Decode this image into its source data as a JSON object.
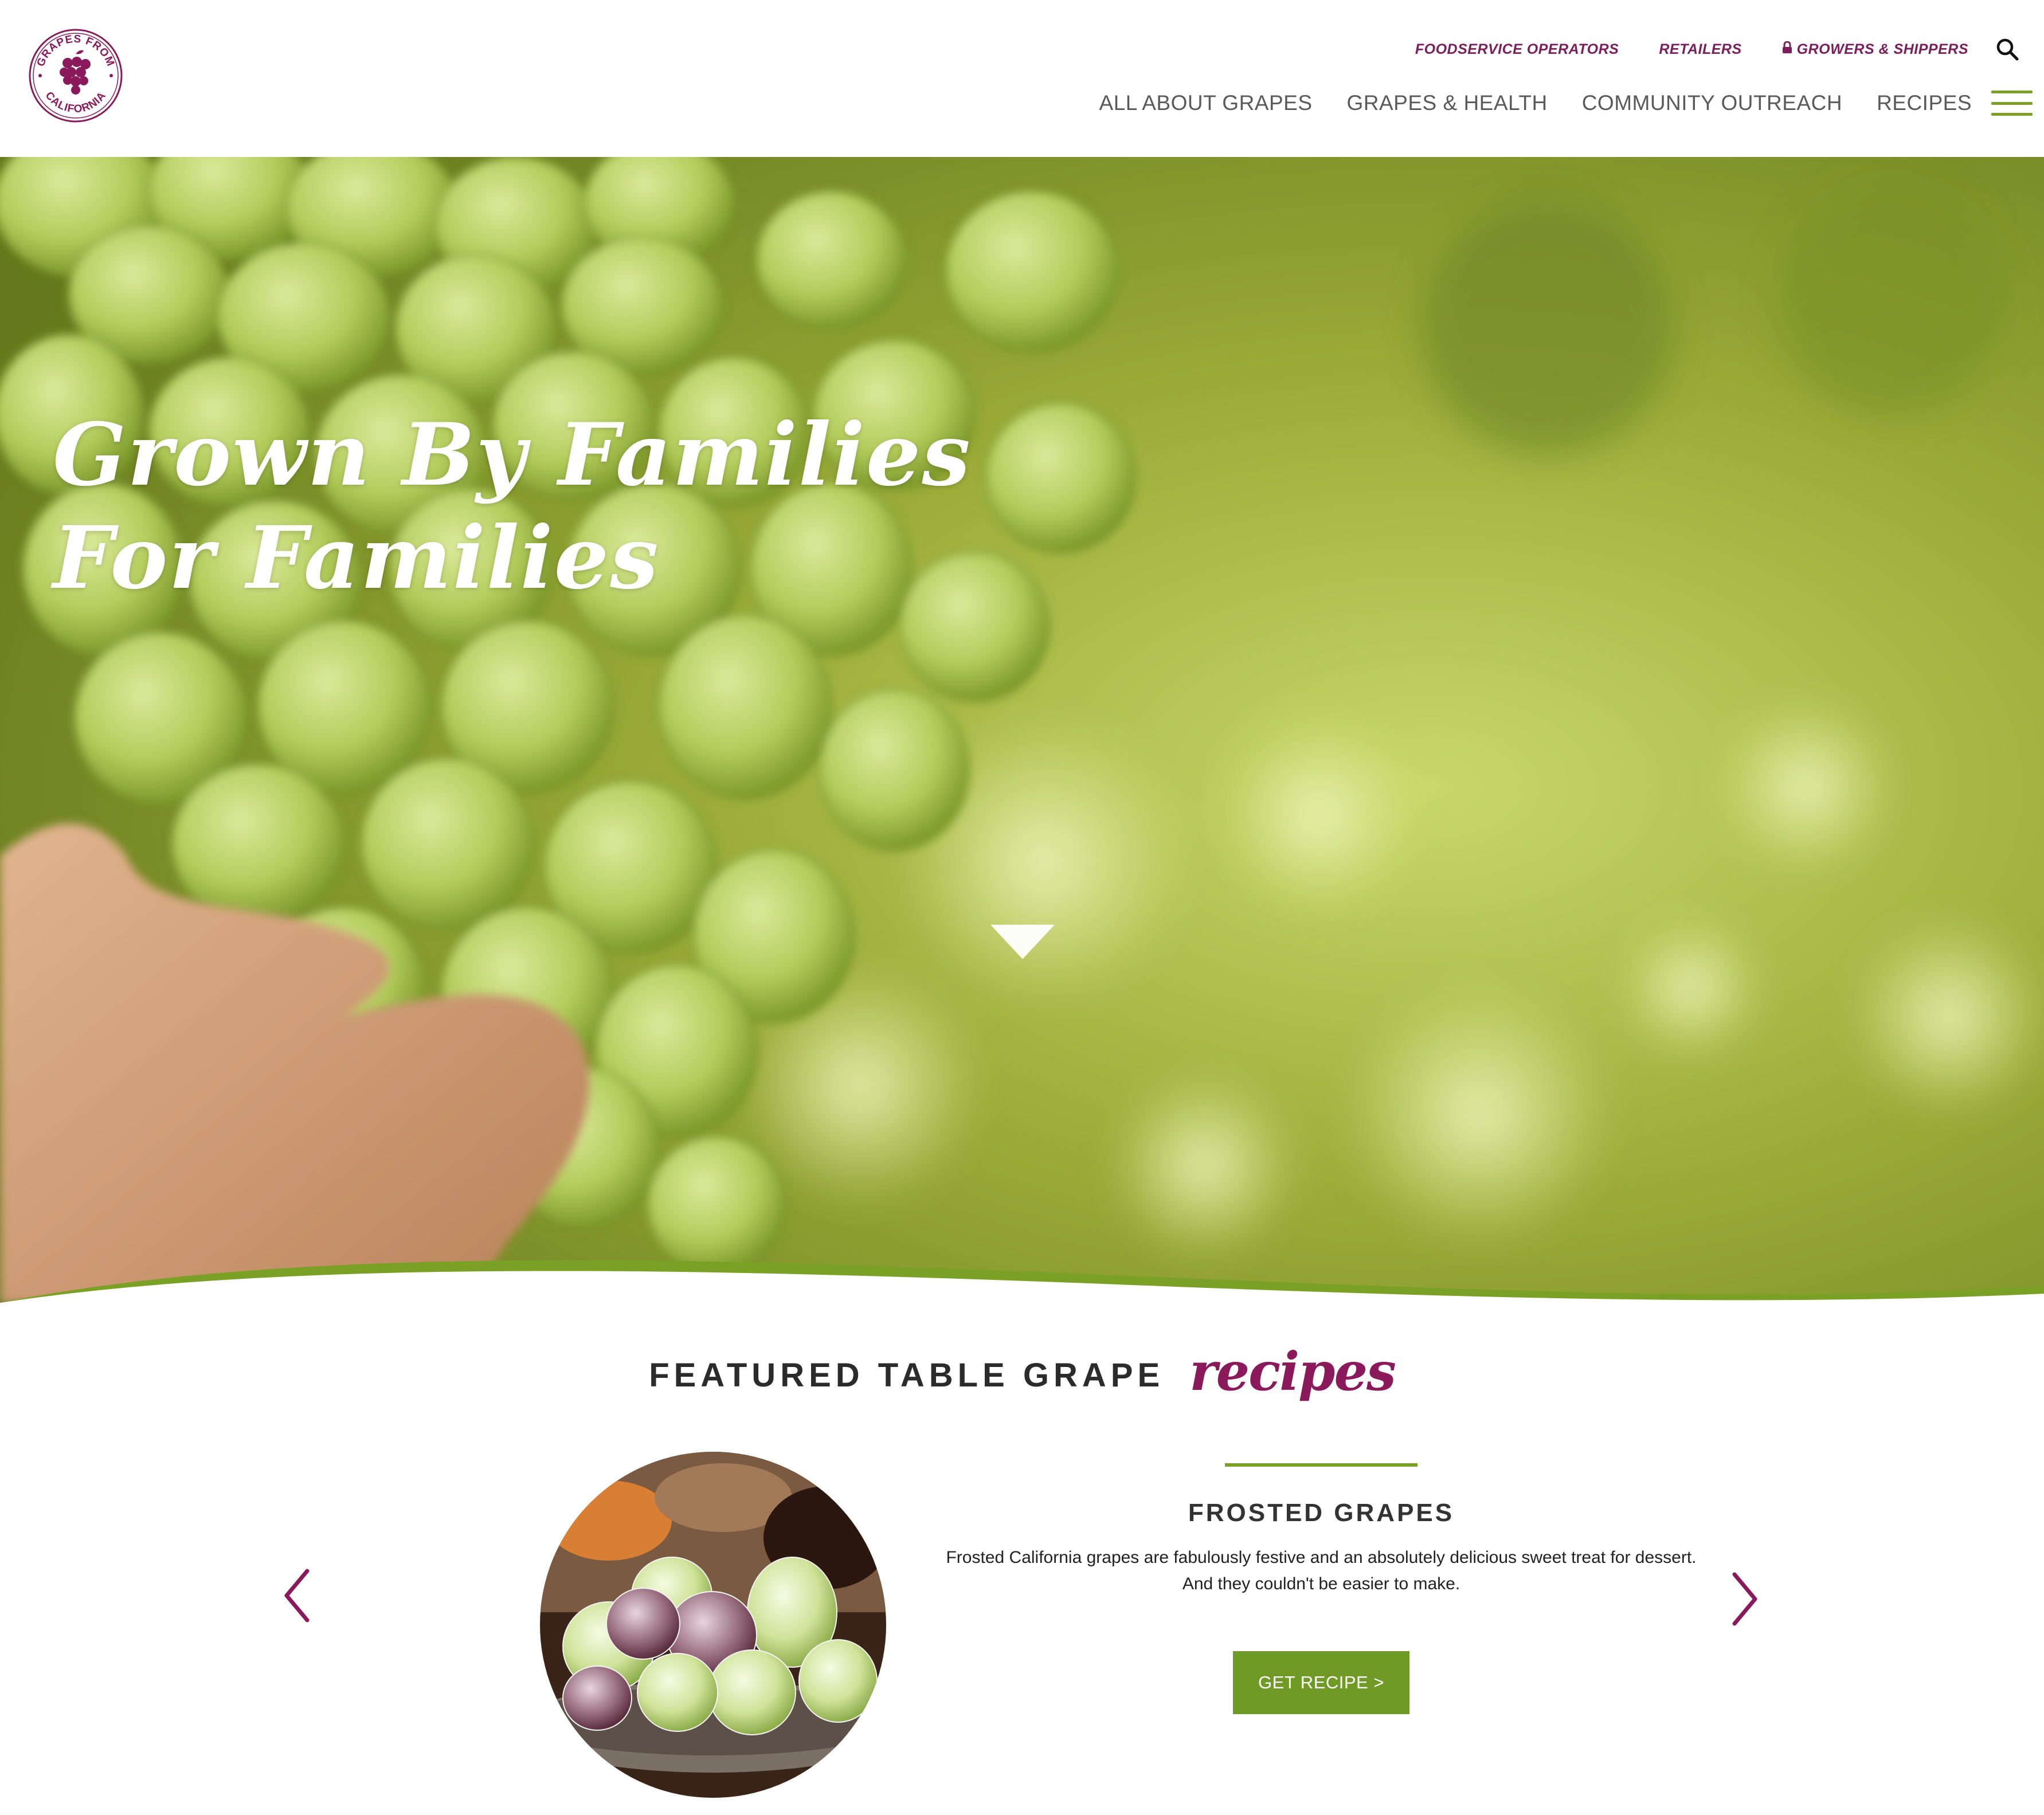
{
  "brand": {
    "logo_top_text": "GRAPES FROM",
    "logo_bottom_text": "CALIFORNIA",
    "primary_color": "#8b1a5c",
    "accent_color": "#7aa125"
  },
  "utility_nav": {
    "foodservice": "FOODSERVICE OPERATORS",
    "retailers": "RETAILERS",
    "growers": "GROWERS & SHIPPERS",
    "lock_icon": "lock-icon",
    "search_icon": "search-icon"
  },
  "main_nav": {
    "items": [
      {
        "label": "ALL ABOUT GRAPES"
      },
      {
        "label": "GRAPES & HEALTH"
      },
      {
        "label": "COMMUNITY OUTREACH"
      },
      {
        "label": "RECIPES"
      }
    ],
    "menu_icon": "hamburger-icon"
  },
  "hero": {
    "title_line1": "Grown By Families",
    "title_line2": "For Families",
    "scroll_icon": "scroll-down-icon"
  },
  "featured": {
    "heading": "FEATURED TABLE GRAPE",
    "heading_script": "recipes",
    "prev_icon": "chevron-left-icon",
    "next_icon": "chevron-right-icon",
    "recipe": {
      "title": "FROSTED GRAPES",
      "description_line1": "Frosted California grapes are fabulously festive and an absolutely delicious sweet treat for dessert.",
      "description_line2": "And they couldn't be easier to make.",
      "button_label": "GET RECIPE >"
    }
  }
}
